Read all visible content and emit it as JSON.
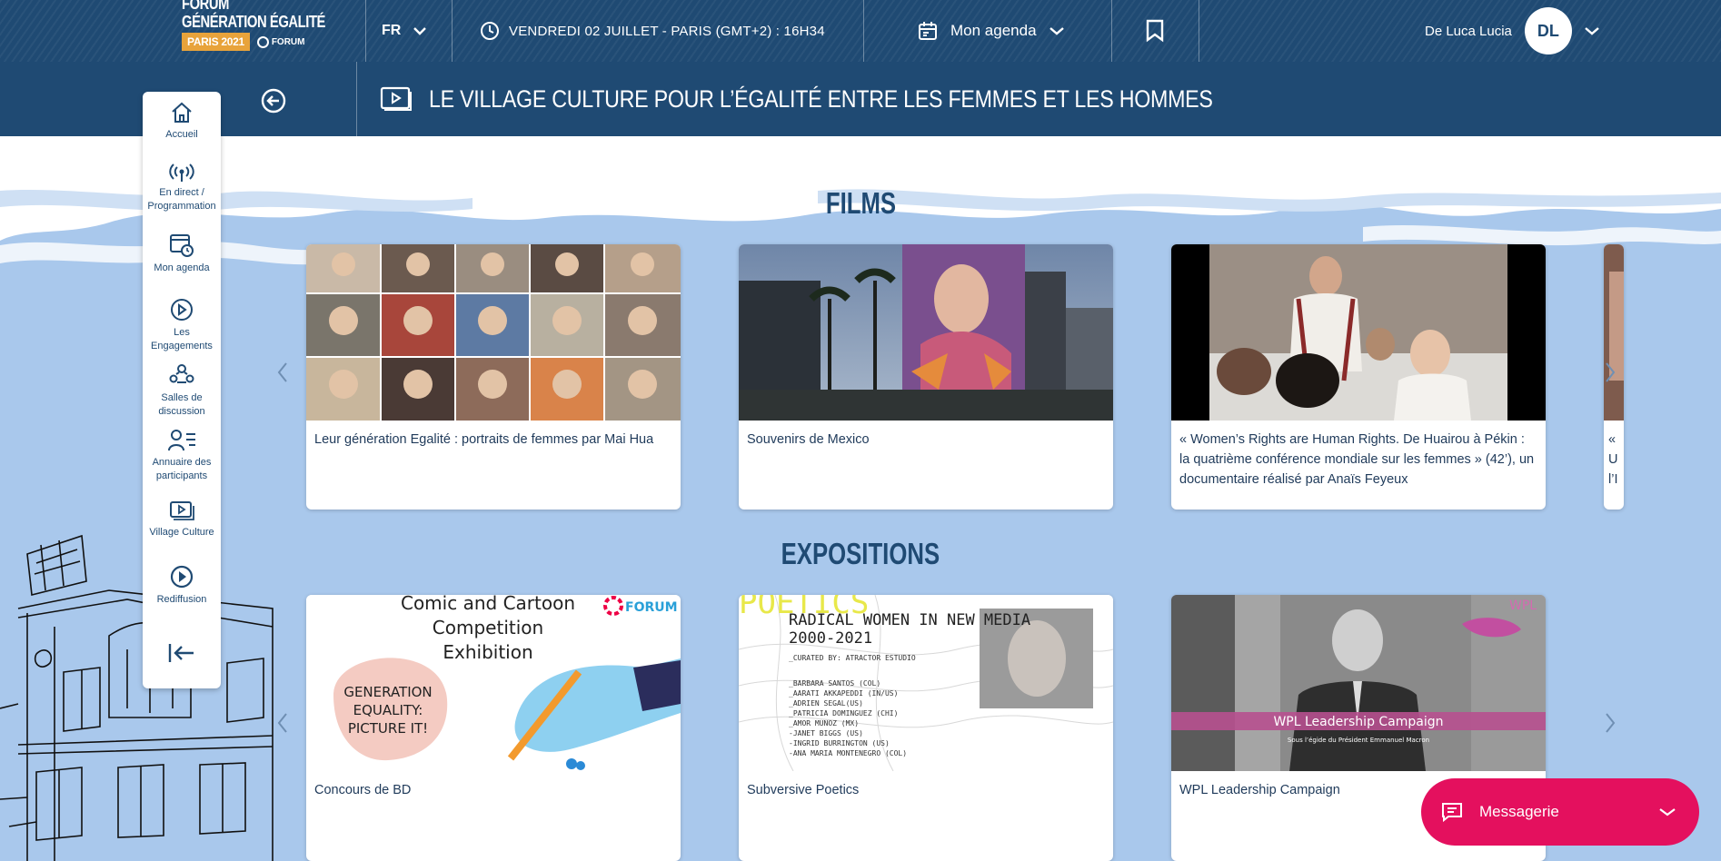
{
  "header": {
    "logo_line1": "FORUM",
    "logo_line2": "GÉNÉRATION ÉGALITÉ",
    "logo_badge": "PARIS 2021",
    "logo_forum": "FORUM",
    "language": "FR",
    "datetime": "VENDREDI 02 JUILLET - PARIS (GMT+2) : 16H34",
    "agenda_label": "Mon agenda",
    "user_name": "De Luca Lucia",
    "user_initials": "DL"
  },
  "page": {
    "title": "LE VILLAGE CULTURE POUR L’ÉGALITÉ ENTRE LES FEMMES ET LES HOMMES"
  },
  "nav": {
    "items": [
      {
        "label": "Accueil",
        "icon": "home-icon"
      },
      {
        "label": "En direct / Programmation",
        "icon": "broadcast-icon"
      },
      {
        "label": "Mon agenda",
        "icon": "calendar-clock-icon"
      },
      {
        "label": "Les Engagements",
        "icon": "engagement-icon"
      },
      {
        "label": "Salles de discussion",
        "icon": "discussion-rooms-icon"
      },
      {
        "label": "Annuaire des participants",
        "icon": "directory-icon"
      },
      {
        "label": "Village Culture",
        "icon": "video-icon"
      },
      {
        "label": "Rediffusion",
        "icon": "play-circle-icon"
      },
      {
        "label": "",
        "icon": "logout-icon"
      }
    ]
  },
  "films": {
    "heading": "FILMS",
    "cards": [
      {
        "caption": "Leur génération Egalité : portraits de femmes par Mai Hua"
      },
      {
        "caption": "Souvenirs de Mexico"
      },
      {
        "caption": "« Women’s Rights are Human Rights. De Huairou à Pékin : la quatrième conférence mondiale sur les femmes » (42’), un documentaire réalisé par Anaïs Feyeux"
      },
      {
        "caption": "« U l’I"
      }
    ]
  },
  "expositions": {
    "heading": "EXPOSITIONS",
    "cards": [
      {
        "caption": "Concours de BD",
        "img_title": "Comic and Cartoon Competition Exhibition",
        "img_bubble": "GENERATION EQUALITY: PICTURE IT!",
        "img_logo": "FORUM"
      },
      {
        "caption": "Subversive Poetics",
        "img_top": "POETICS",
        "img_title": "RADICAL WOMEN IN NEW MEDIA 2000-2021",
        "img_curated": "_CURATED BY: ATRACTOR ESTUDIO",
        "img_names": [
          "_BARBARA SANTOS (COL)",
          "_AARATI AKKAPEDDI (IN/US)",
          "_ADRIEN SEGAL(US)",
          "_PATRICIA DOMINGUEZ (CHI)",
          "_AMOR MUNOZ (MX)",
          "-JANET BIGGS (US)",
          "-INGRID BURRINGTON (US)",
          "-ANA MARIA MONTENEGRO (COL)"
        ]
      },
      {
        "caption": "WPL Leadership Campaign",
        "img_banner": "WPL Leadership Campaign",
        "img_sub": "Sous l’égide du Président Emmanuel Macron",
        "img_logo": "WPL"
      }
    ]
  },
  "messaging": {
    "label": "Messagerie"
  }
}
